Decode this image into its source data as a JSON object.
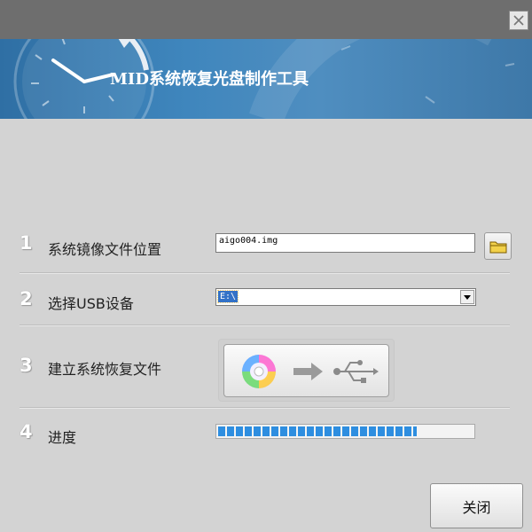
{
  "window": {
    "title": "MID系统恢复光盘制作工具",
    "close_icon": "close-icon"
  },
  "steps": [
    {
      "number": "1",
      "label": "系统镜像文件位置",
      "input_value": "aigo004.img",
      "button_icon": "folder-icon"
    },
    {
      "number": "2",
      "label": "选择USB设备",
      "selected_value": "E:\\",
      "dropdown_icon": "chevron-down-icon"
    },
    {
      "number": "3",
      "label": "建立系统恢复文件",
      "button_icons": [
        "disc-icon",
        "arrow-right-icon",
        "usb-icon"
      ]
    },
    {
      "number": "4",
      "label": "进度",
      "progress_fraction": 0.78
    }
  ],
  "footer": {
    "close_label": "关闭"
  },
  "colors": {
    "accent": "#2e8ee0",
    "banner": "#3f86bd",
    "background": "#d3d3d3"
  }
}
